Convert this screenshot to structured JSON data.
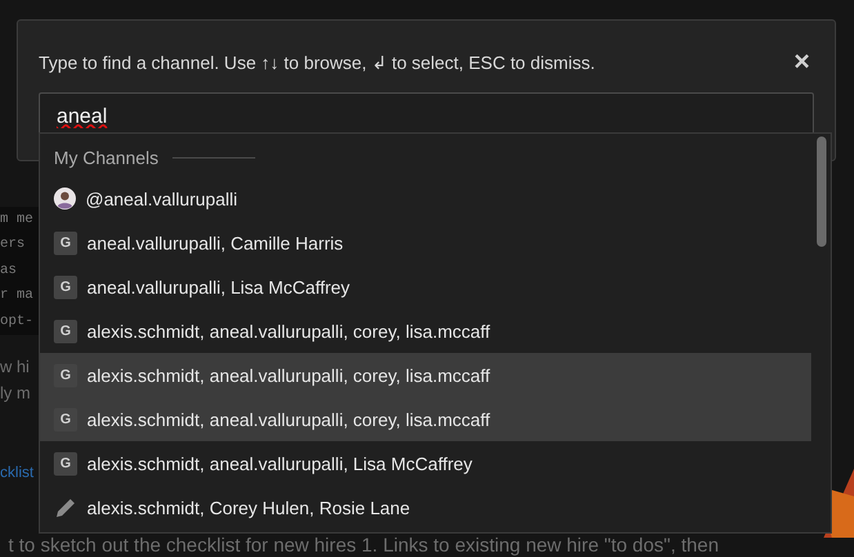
{
  "background": {
    "rows": [
      {
        "kind": "code",
        "text": "m me"
      },
      {
        "kind": "code",
        "text": "ers"
      },
      {
        "kind": "code",
        "text": "as"
      },
      {
        "kind": "code",
        "text": "r ma"
      },
      {
        "kind": "code",
        "text": "opt-"
      },
      {
        "kind": "text",
        "text": "w hi"
      },
      {
        "kind": "text",
        "text": "ly m"
      },
      {
        "kind": "link",
        "text": "cklist"
      }
    ],
    "bottom_line": "t to sketch out the checklist for new hires 1. Links to existing new hire \"to dos\", then"
  },
  "modal": {
    "hint": "Type to find a channel. Use ↑↓ to browse, ↲ to select, ESC to dismiss.",
    "close": "×",
    "search": {
      "value": "aneal"
    },
    "section_title": "My Channels",
    "results": [
      {
        "kind": "user",
        "label": "@aneal.vallurupalli",
        "selected": false
      },
      {
        "kind": "group",
        "badge": "G",
        "label": "aneal.vallurupalli, Camille Harris",
        "selected": false
      },
      {
        "kind": "group",
        "badge": "G",
        "label": "aneal.vallurupalli, Lisa McCaffrey",
        "selected": false
      },
      {
        "kind": "group",
        "badge": "G",
        "label": "alexis.schmidt, aneal.vallurupalli, corey, lisa.mccaff",
        "selected": false
      },
      {
        "kind": "group",
        "badge": "G",
        "label": "alexis.schmidt, aneal.vallurupalli, corey, lisa.mccaff",
        "selected": true
      },
      {
        "kind": "group",
        "badge": "G",
        "label": "alexis.schmidt, aneal.vallurupalli, corey, lisa.mccaff",
        "selected": true
      },
      {
        "kind": "group",
        "badge": "G",
        "label": "alexis.schmidt, aneal.vallurupalli, Lisa McCaffrey",
        "selected": false
      },
      {
        "kind": "draft",
        "label": "alexis.schmidt, Corey Hulen, Rosie Lane",
        "selected": false
      }
    ]
  }
}
